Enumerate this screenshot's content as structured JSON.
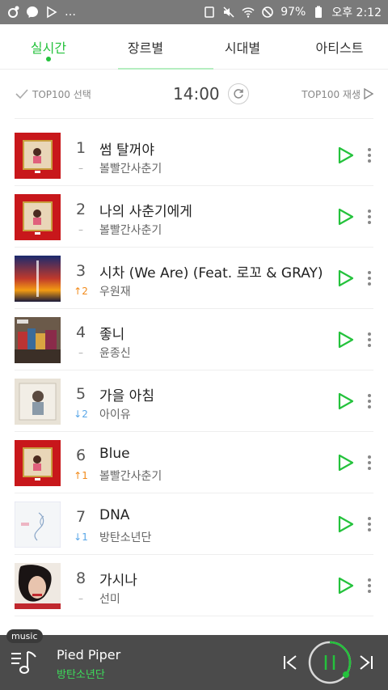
{
  "status": {
    "battery": "97%",
    "time": "오후 2:12"
  },
  "tabs": [
    {
      "label": "실시간"
    },
    {
      "label": "장르별"
    },
    {
      "label": "시대별"
    },
    {
      "label": "아티스트"
    }
  ],
  "controls": {
    "select_label": "TOP100 선택",
    "time": "14:00",
    "play_label": "TOP100 재생"
  },
  "chart": [
    {
      "rank": "1",
      "change": "–",
      "title": "썸 탈꺼야",
      "artist": "볼빨간사춘기"
    },
    {
      "rank": "2",
      "change": "–",
      "title": "나의 사춘기에게",
      "artist": "볼빨간사춘기"
    },
    {
      "rank": "3",
      "change": "↑2",
      "title": "시차 (We Are) (Feat. 로꼬 & GRAY)",
      "artist": "우원재"
    },
    {
      "rank": "4",
      "change": "–",
      "title": "좋니",
      "artist": "윤종신"
    },
    {
      "rank": "5",
      "change": "↓2",
      "title": "가을 아침",
      "artist": "아이유"
    },
    {
      "rank": "6",
      "change": "↑1",
      "title": "Blue",
      "artist": "볼빨간사춘기"
    },
    {
      "rank": "7",
      "change": "↓1",
      "title": "DNA",
      "artist": "방탄소년단"
    },
    {
      "rank": "8",
      "change": "–",
      "title": "가시나",
      "artist": "선미"
    }
  ],
  "player": {
    "badge": "music",
    "title": "Pied Piper",
    "artist": "방탄소년단"
  },
  "colors": {
    "accent": "#24c23c",
    "up": "#f28a1a",
    "down": "#5aa7e8"
  }
}
